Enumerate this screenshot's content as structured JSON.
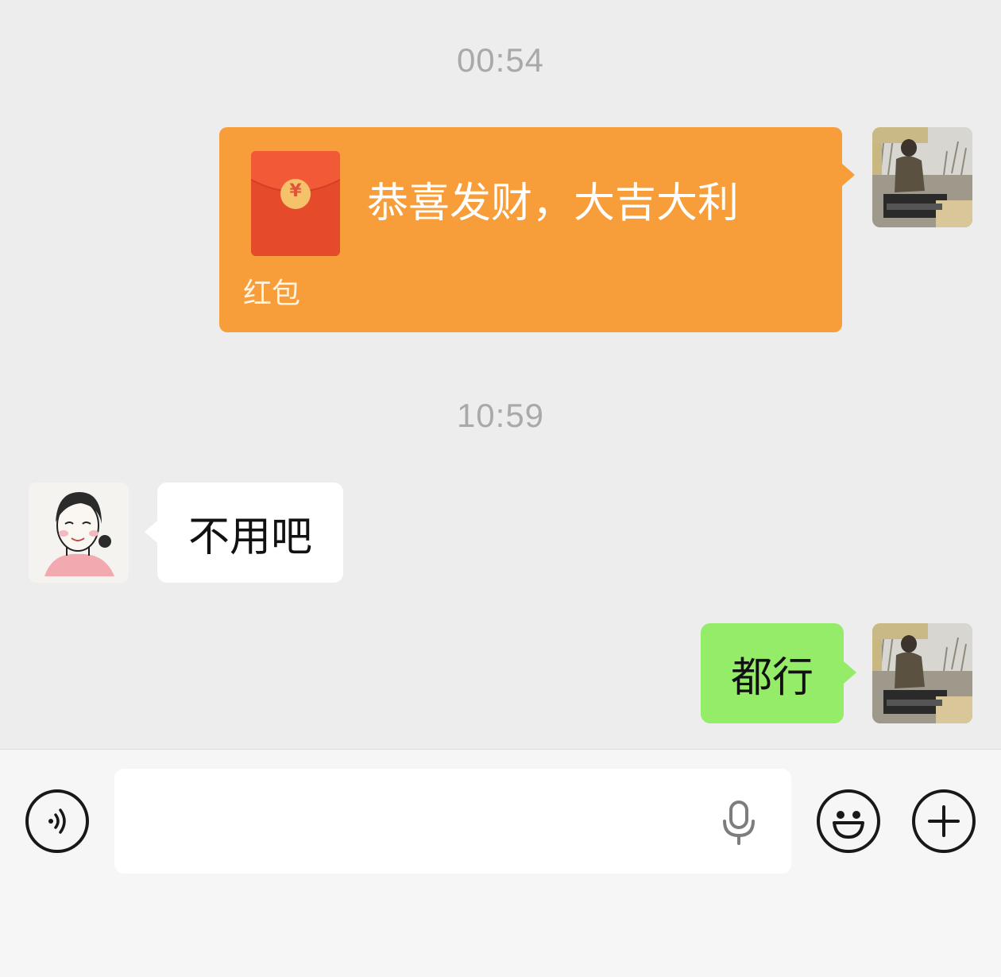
{
  "messages": {
    "timestamp_1": "00:54",
    "red_packet": {
      "title": "恭喜发财，大吉大利",
      "label": "红包",
      "currency_symbol": "¥",
      "colors": {
        "bubble": "#f79d39",
        "envelope": "#e54a2a",
        "coin": "#f5c26b"
      }
    },
    "timestamp_2": "10:59",
    "received_text": "不用吧",
    "sent_text": "都行"
  },
  "input_bar": {
    "text_value": "",
    "voice_icon": "voice-mode-icon",
    "mic_icon": "microphone-icon",
    "emoji_icon": "emoji-icon",
    "plus_icon": "plus-icon"
  },
  "colors": {
    "background": "#ededed",
    "sent_bubble": "#95ec69",
    "received_bubble": "#ffffff",
    "timestamp": "#a9a9a9",
    "input_bar": "#f6f6f6"
  }
}
